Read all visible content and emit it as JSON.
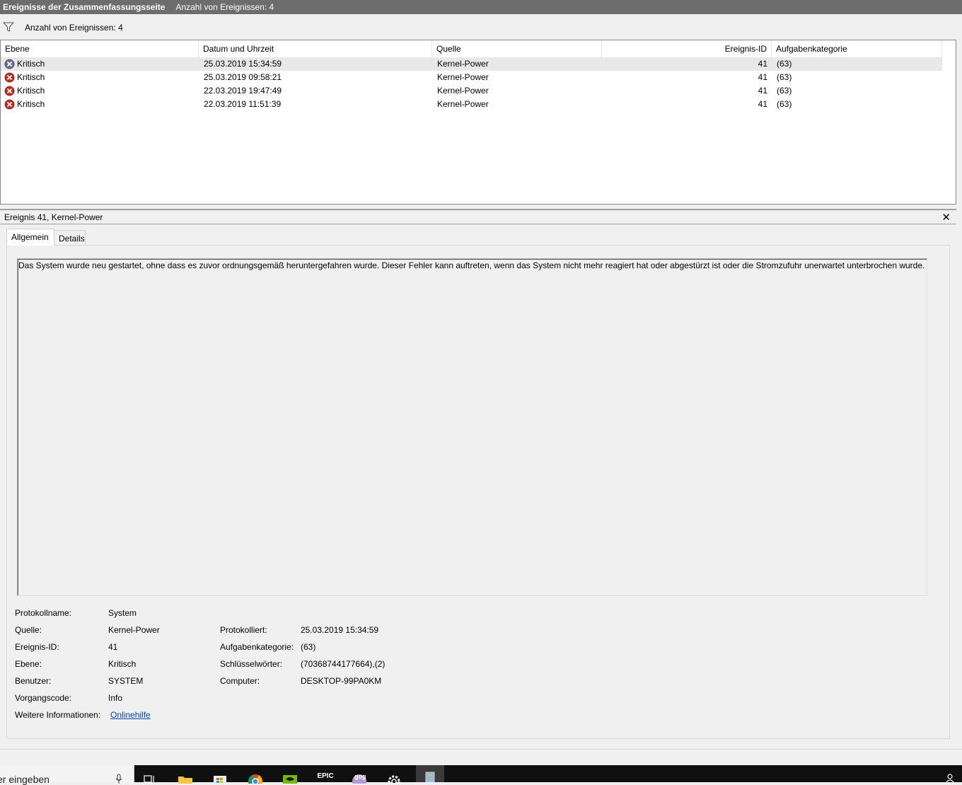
{
  "titlebar": {
    "title": "Ereignisse der Zusammenfassungsseite",
    "count": "Anzahl von Ereignissen: 4"
  },
  "filter": {
    "label": "Anzahl von Ereignissen: 4"
  },
  "columns": {
    "level": "Ebene",
    "datetime": "Datum und Uhrzeit",
    "source": "Quelle",
    "eventid": "Ereignis-ID",
    "category": "Aufgabenkategorie"
  },
  "events": [
    {
      "level": "Kritisch",
      "datetime": "25.03.2019 15:34:59",
      "source": "Kernel-Power",
      "eventid": "41",
      "category": "(63)"
    },
    {
      "level": "Kritisch",
      "datetime": "25.03.2019 09:58:21",
      "source": "Kernel-Power",
      "eventid": "41",
      "category": "(63)"
    },
    {
      "level": "Kritisch",
      "datetime": "22.03.2019 19:47:49",
      "source": "Kernel-Power",
      "eventid": "41",
      "category": "(63)"
    },
    {
      "level": "Kritisch",
      "datetime": "22.03.2019 11:51:39",
      "source": "Kernel-Power",
      "eventid": "41",
      "category": "(63)"
    }
  ],
  "detail": {
    "title": "Ereignis 41, Kernel-Power",
    "close": "✕",
    "tabs": {
      "general": "Allgemein",
      "details": "Details"
    },
    "description": "Das System wurde neu gestartet, ohne dass es zuvor ordnungsgemäß heruntergefahren wurde. Dieser Fehler kann auftreten, wenn das System nicht mehr reagiert hat oder abgestürzt ist oder die Stromzufuhr unerwartet unterbrochen wurde.",
    "props": {
      "logname_label": "Protokollname:",
      "logname": "System",
      "source_label": "Quelle:",
      "source": "Kernel-Power",
      "logged_label": "Protokolliert:",
      "logged": "25.03.2019 15:34:59",
      "eventid_label": "Ereignis-ID:",
      "eventid": "41",
      "taskcat_label": "Aufgabenkategorie:",
      "taskcat": "(63)",
      "level_label": "Ebene:",
      "level": "Kritisch",
      "keywords_label": "Schlüsselwörter:",
      "keywords": "(70368744177664),(2)",
      "user_label": "Benutzer:",
      "user": "SYSTEM",
      "computer_label": "Computer:",
      "computer": "DESKTOP-99PA0KM",
      "opcode_label": "Vorgangscode:",
      "opcode": "Info",
      "moreinfo_label": "Weitere Informationen:",
      "moreinfo": "Onlinehilfe"
    }
  },
  "taskbar": {
    "search_text": "er eingeben",
    "icons": [
      "microphone-icon",
      "task-view-icon",
      "file-explorer-icon",
      "store-icon",
      "chrome-icon",
      "nvidia-icon",
      "epic-games-icon",
      "gog-icon",
      "settings-icon",
      "event-viewer-icon"
    ],
    "epic_label": "EPIC",
    "gog_label": "gog"
  },
  "colors": {
    "titlebar": "#6d6d6d",
    "critical": "#c42b1c",
    "link": "#0645ad",
    "taskbar": "#101010"
  }
}
